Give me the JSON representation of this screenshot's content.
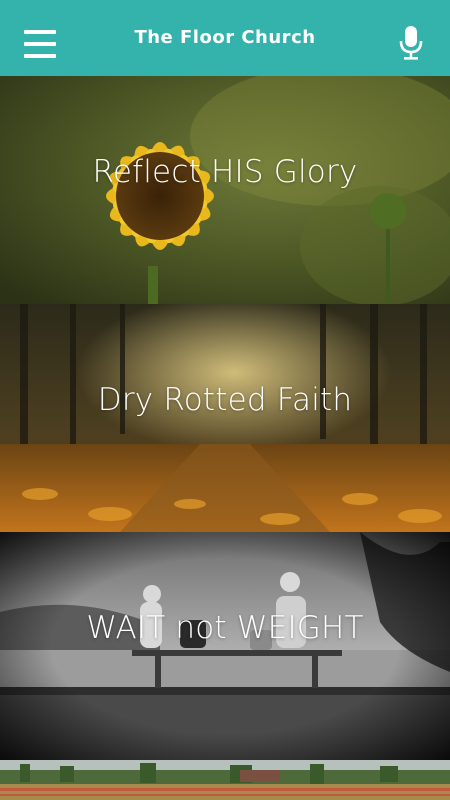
{
  "app_bar": {
    "title": "The Floor Church",
    "menu_icon": "hamburger-menu-icon",
    "mic_icon": "microphone-icon",
    "background": "#34b2ac"
  },
  "cards": [
    {
      "title": "Reflect HIS Glory"
    },
    {
      "title": "Dry Rotted Faith"
    },
    {
      "title": "WAIT not WEIGHT"
    },
    {
      "title": ""
    }
  ]
}
